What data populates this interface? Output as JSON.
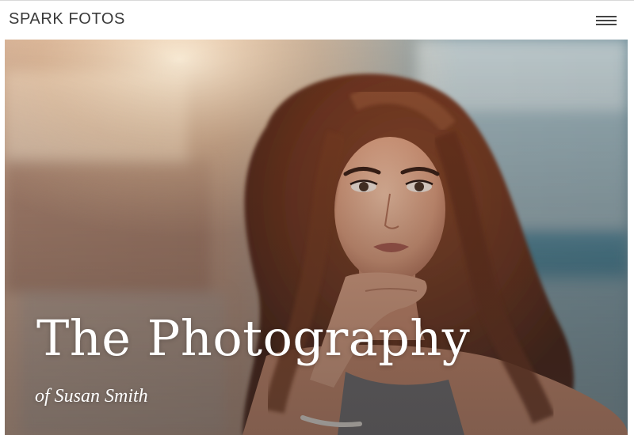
{
  "header": {
    "brand": "SPARK FOTOS",
    "menu_icon": "hamburger-menu-icon"
  },
  "hero": {
    "title": "The Photography",
    "subtitle": "of Susan Smith",
    "image": "portrait photo of a woman with long wavy auburn hair resting her chin on her hand"
  },
  "colors": {
    "header_bg": "#ffffff",
    "brand_text": "#3a3a3a",
    "menu_icon": "#444444",
    "hero_text": "#ffffff"
  }
}
